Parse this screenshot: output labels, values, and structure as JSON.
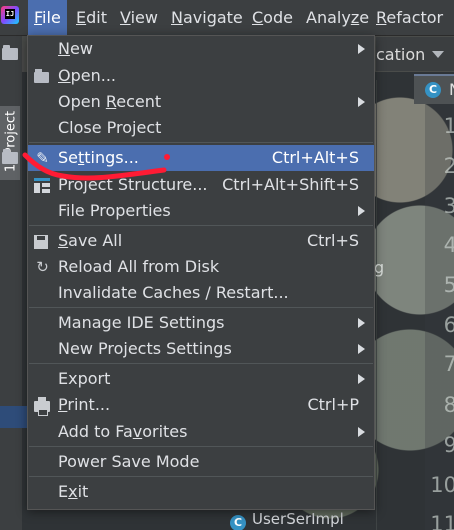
{
  "menu_bar": {
    "items": [
      "File",
      "Edit",
      "View",
      "Navigate",
      "Code",
      "Analyze",
      "Refactor"
    ],
    "mnemonics": [
      "F",
      "E",
      "V",
      "N",
      "C",
      "z",
      "R"
    ]
  },
  "tool_window": {
    "project_tab_label": "1: Project"
  },
  "toolbar": {
    "run_config_partial": "cation"
  },
  "editor": {
    "tab_partial_letter": "N",
    "line_numbers": [
      "1",
      "2",
      "3",
      "4",
      "5",
      "6",
      "7",
      "8",
      "9",
      "10",
      "11"
    ],
    "partial_code_char": "g"
  },
  "project_tree": {
    "visible_file": "UserSerImpl"
  },
  "file_menu": {
    "items": [
      {
        "label": "New",
        "mnemonic": "N",
        "shortcut": "",
        "submenu": true
      },
      {
        "label": "Open...",
        "mnemonic": "O",
        "shortcut": "",
        "submenu": false
      },
      {
        "label": "Open Recent",
        "mnemonic": "R",
        "shortcut": "",
        "submenu": true
      },
      {
        "label": "Close Project",
        "mnemonic": "",
        "shortcut": "",
        "submenu": false
      },
      {
        "label": "Settings...",
        "mnemonic": "t",
        "shortcut": "Ctrl+Alt+S",
        "submenu": false
      },
      {
        "label": "Project Structure...",
        "mnemonic": "",
        "shortcut": "Ctrl+Alt+Shift+S",
        "submenu": false
      },
      {
        "label": "File Properties",
        "mnemonic": "",
        "shortcut": "",
        "submenu": true
      },
      {
        "label": "Save All",
        "mnemonic": "S",
        "shortcut": "Ctrl+S",
        "submenu": false
      },
      {
        "label": "Reload All from Disk",
        "mnemonic": "",
        "shortcut": "",
        "submenu": false
      },
      {
        "label": "Invalidate Caches / Restart...",
        "mnemonic": "",
        "shortcut": "",
        "submenu": false
      },
      {
        "label": "Manage IDE Settings",
        "mnemonic": "",
        "shortcut": "",
        "submenu": true
      },
      {
        "label": "New Projects Settings",
        "mnemonic": "",
        "shortcut": "",
        "submenu": true
      },
      {
        "label": "Export",
        "mnemonic": "",
        "shortcut": "",
        "submenu": true
      },
      {
        "label": "Print...",
        "mnemonic": "P",
        "shortcut": "Ctrl+P",
        "submenu": false
      },
      {
        "label": "Add to Favorites",
        "mnemonic": "v",
        "shortcut": "",
        "submenu": true
      },
      {
        "label": "Power Save Mode",
        "mnemonic": "",
        "shortcut": "",
        "submenu": false
      },
      {
        "label": "Exit",
        "mnemonic": "x",
        "shortcut": "",
        "submenu": false
      }
    ]
  },
  "colors": {
    "menu_bg": "#3c3f41",
    "selection": "#4b6eaf",
    "text": "#dfe1e5",
    "annotation_red": "#ff1b34"
  },
  "icons": {
    "open": "folder-open-icon",
    "settings": "wrench-icon",
    "project_structure": "project-structure-icon",
    "save": "save-icon",
    "reload": "reload-icon",
    "print": "printer-icon"
  }
}
